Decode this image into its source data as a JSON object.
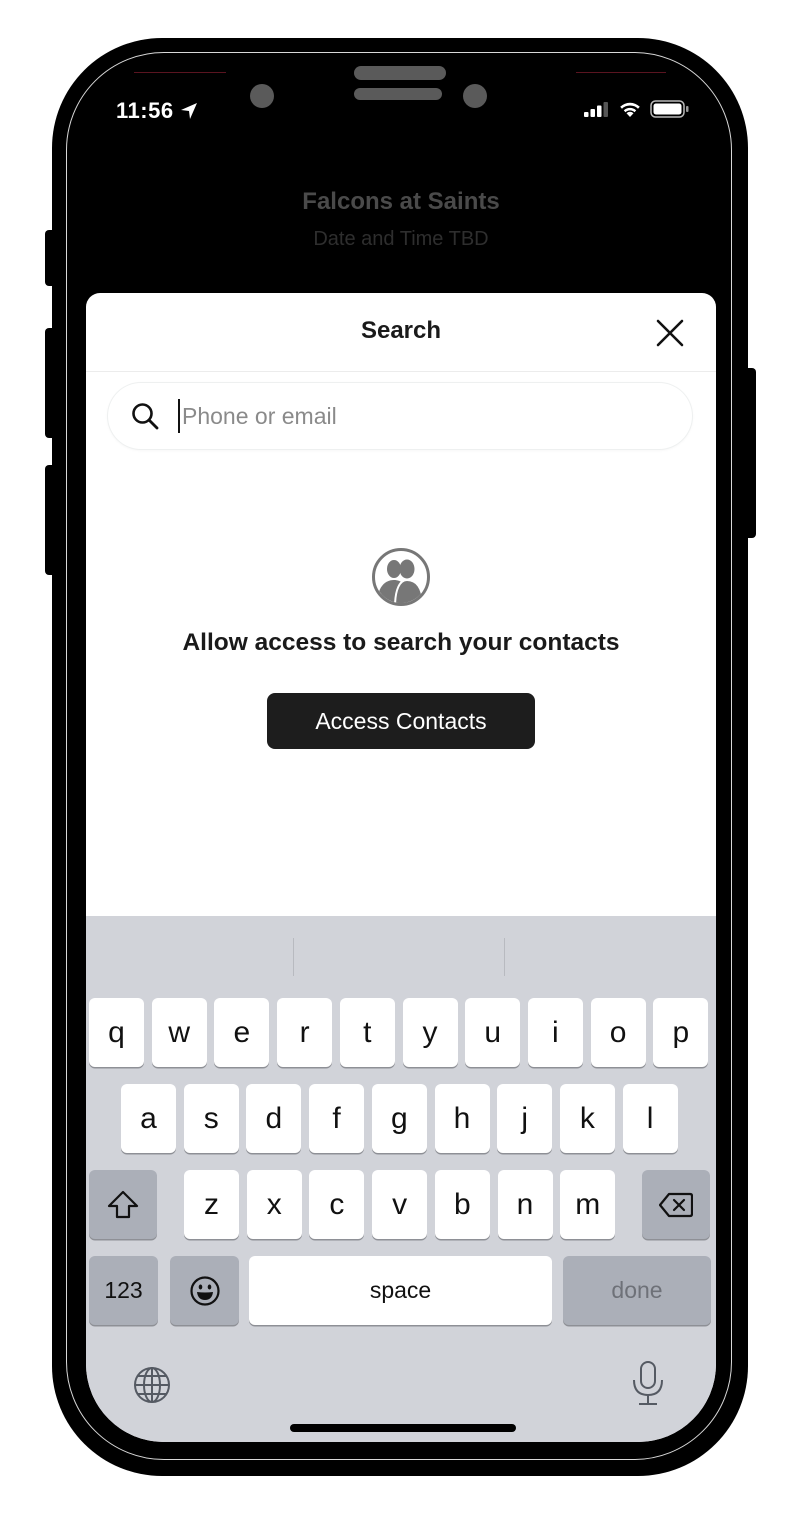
{
  "status_bar": {
    "time": "11:56",
    "location_icon": "location-arrow-icon",
    "signal_icon": "cellular-signal-icon",
    "wifi_icon": "wifi-icon",
    "battery_icon": "battery-icon"
  },
  "background_app": {
    "title": "Falcons at Saints",
    "subtitle": "Date and Time TBD"
  },
  "sheet": {
    "title": "Search",
    "close_icon": "close-icon",
    "search": {
      "icon": "search-icon",
      "value": "",
      "placeholder": "Phone or email"
    },
    "empty_state": {
      "icon": "contacts-icon",
      "message": "Allow access to search your contacts",
      "button_label": "Access Contacts"
    }
  },
  "keyboard": {
    "row1": [
      "q",
      "w",
      "e",
      "r",
      "t",
      "y",
      "u",
      "i",
      "o",
      "p"
    ],
    "row2": [
      "a",
      "s",
      "d",
      "f",
      "g",
      "h",
      "j",
      "k",
      "l"
    ],
    "row3": [
      "z",
      "x",
      "c",
      "v",
      "b",
      "n",
      "m"
    ],
    "shift_icon": "shift-icon",
    "backspace_icon": "backspace-icon",
    "numbers_label": "123",
    "emoji_icon": "emoji-icon",
    "space_label": "space",
    "done_label": "done",
    "globe_icon": "globe-icon",
    "mic_icon": "microphone-icon"
  },
  "colors": {
    "keyboard_bg": "#d1d3d9",
    "func_key_bg": "#abafb8",
    "button_bg": "#1d1d1d"
  }
}
